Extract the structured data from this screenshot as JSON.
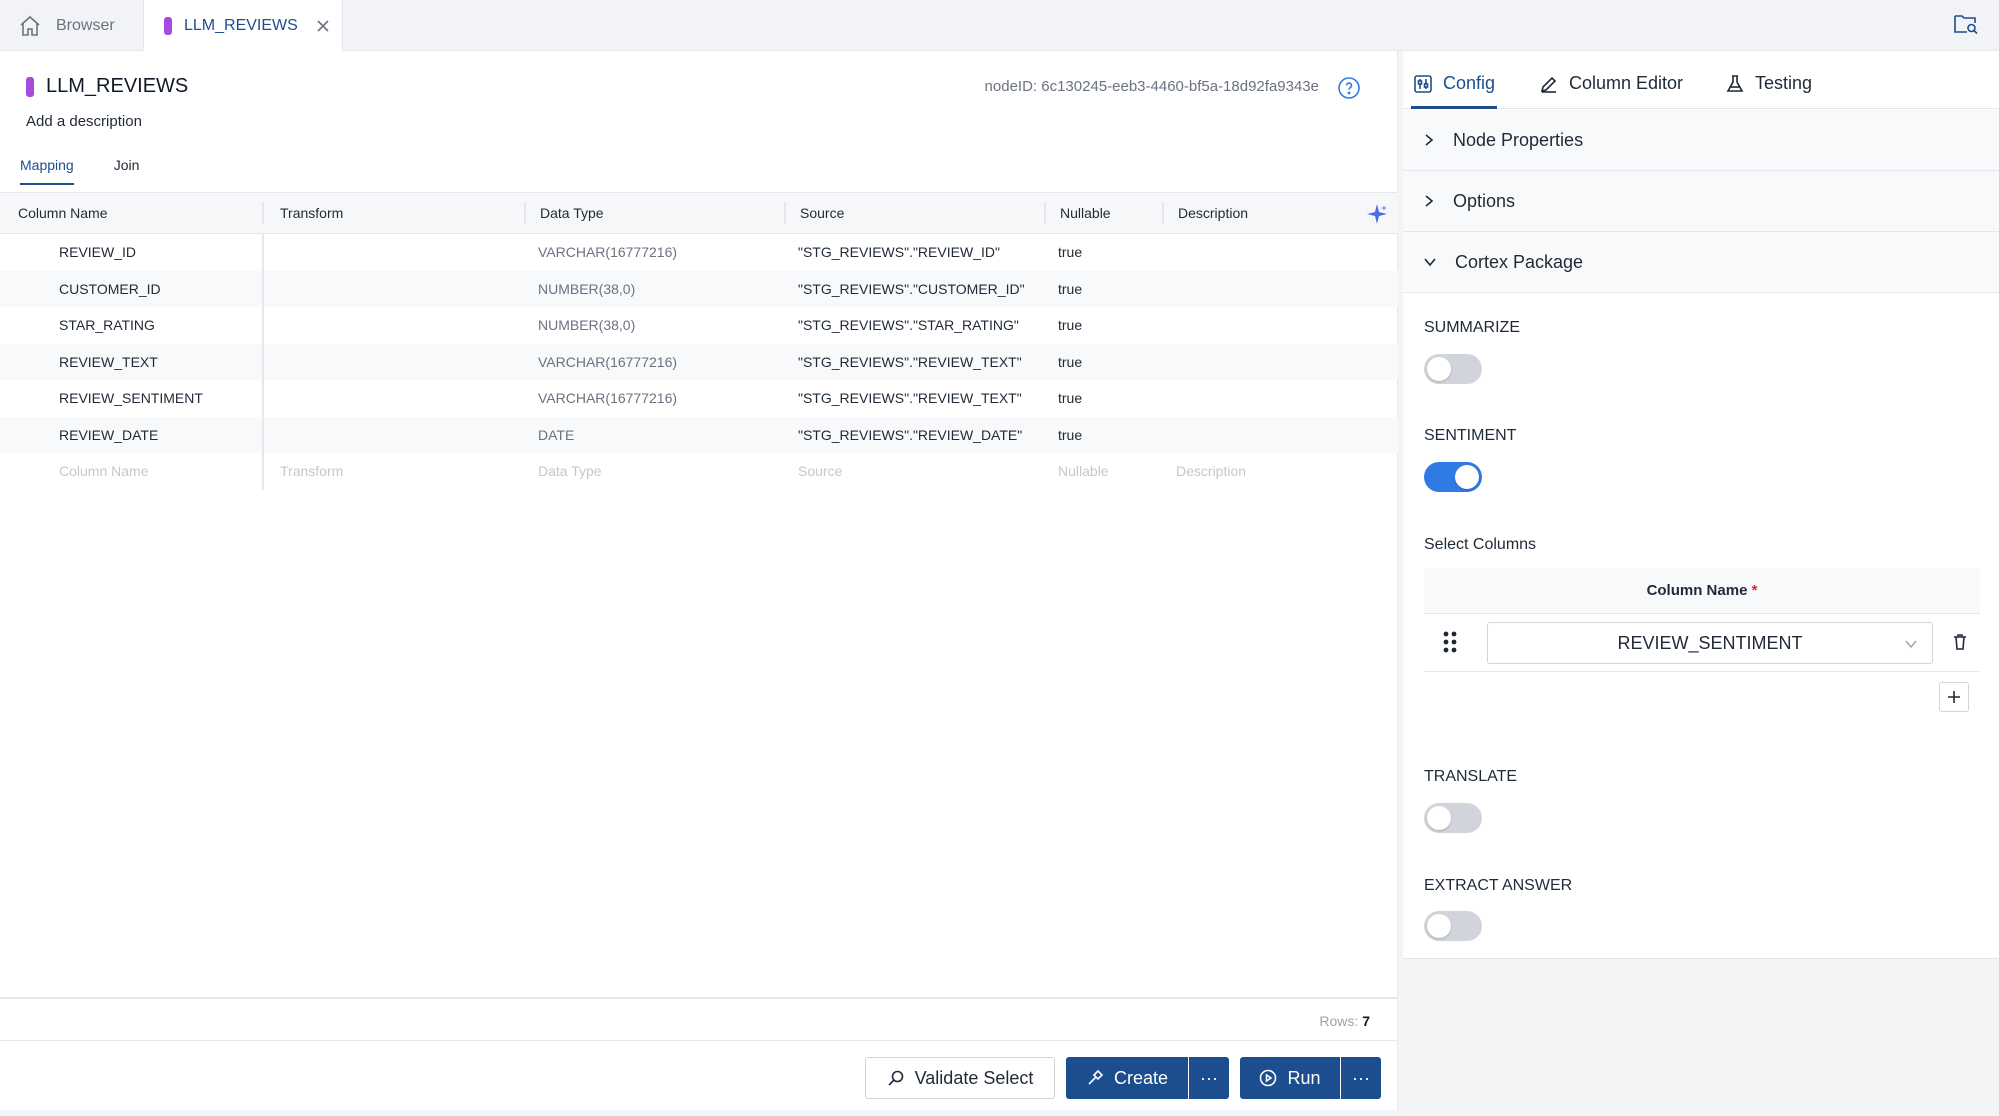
{
  "tabs": {
    "browser_label": "Browser",
    "active_label": "LLM_REVIEWS"
  },
  "node": {
    "title": "LLM_REVIEWS",
    "description": "Add a description",
    "node_id": "nodeID: 6c130245-eeb3-4460-bf5a-18d92fa9343e",
    "pill_color": "#a64bdc"
  },
  "subtabs": [
    "Mapping",
    "Join"
  ],
  "grid": {
    "headers": [
      "Column Name",
      "Transform",
      "Data Type",
      "Source",
      "Nullable",
      "Description"
    ],
    "rows": [
      {
        "name": "REVIEW_ID",
        "transform": "",
        "type": "VARCHAR(16777216)",
        "source": "\"STG_REVIEWS\".\"REVIEW_ID\"",
        "nullable": "true",
        "description": ""
      },
      {
        "name": "CUSTOMER_ID",
        "transform": "",
        "type": "NUMBER(38,0)",
        "source": "\"STG_REVIEWS\".\"CUSTOMER_ID\"",
        "nullable": "true",
        "description": ""
      },
      {
        "name": "STAR_RATING",
        "transform": "",
        "type": "NUMBER(38,0)",
        "source": "\"STG_REVIEWS\".\"STAR_RATING\"",
        "nullable": "true",
        "description": ""
      },
      {
        "name": "REVIEW_TEXT",
        "transform": "",
        "type": "VARCHAR(16777216)",
        "source": "\"STG_REVIEWS\".\"REVIEW_TEXT\"",
        "nullable": "true",
        "description": ""
      },
      {
        "name": "REVIEW_SENTIMENT",
        "transform": "",
        "type": "VARCHAR(16777216)",
        "source": "\"STG_REVIEWS\".\"REVIEW_TEXT\"",
        "nullable": "true",
        "description": ""
      },
      {
        "name": "REVIEW_DATE",
        "transform": "",
        "type": "DATE",
        "source": "\"STG_REVIEWS\".\"REVIEW_DATE\"",
        "nullable": "true",
        "description": ""
      }
    ],
    "placeholders": {
      "name": "Column Name",
      "transform": "Transform",
      "type": "Data Type",
      "source": "Source",
      "nullable": "Nullable",
      "description": "Description"
    }
  },
  "rows_count": {
    "label": "Rows:",
    "value": "7"
  },
  "buttons": {
    "validate": "Validate Select",
    "create": "Create",
    "run": "Run",
    "more": "···"
  },
  "side": {
    "tabs": [
      "Config",
      "Column Editor",
      "Testing"
    ],
    "accordions": [
      "Node Properties",
      "Options",
      "Cortex Package"
    ],
    "summarize": {
      "label": "SUMMARIZE",
      "on": false
    },
    "sentiment": {
      "label": "SENTIMENT",
      "on": true
    },
    "select_columns": "Select Columns",
    "column_name_header": "Column Name",
    "required_mark": "*",
    "selected_column": "REVIEW_SENTIMENT",
    "translate": {
      "label": "TRANSLATE",
      "on": false
    },
    "extract_answer": {
      "label": "EXTRACT ANSWER",
      "on": false
    }
  },
  "colors": {
    "accent": "#1e4e8c",
    "button": "#1b4d8f",
    "toggle_on": "#2f7ae5"
  }
}
